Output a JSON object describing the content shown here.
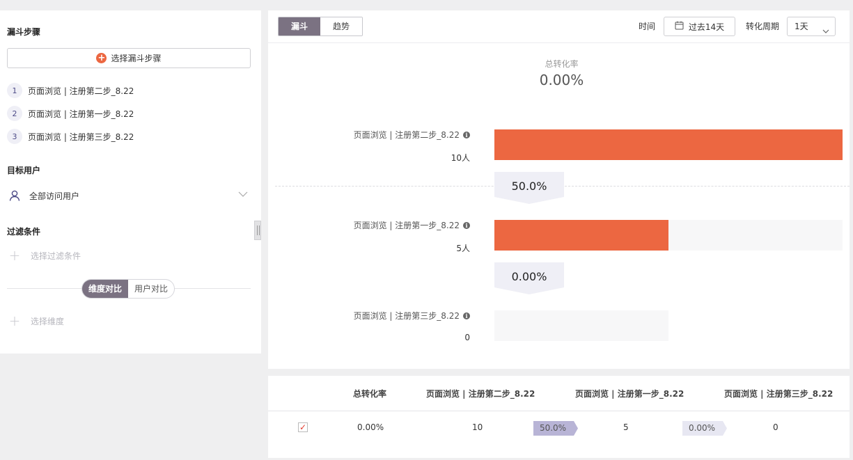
{
  "left_panel": {
    "funnel_steps_title": "漏斗步骤",
    "select_steps_label": "选择漏斗步骤",
    "steps": [
      {
        "num": "1",
        "label": "页面浏览 | 注册第二步_8.22"
      },
      {
        "num": "2",
        "label": "页面浏览 | 注册第一步_8.22"
      },
      {
        "num": "3",
        "label": "页面浏览 | 注册第三步_8.22"
      }
    ],
    "target_users_title": "目标用户",
    "target_users_value": "全部访问用户",
    "filter_title": "过滤条件",
    "filter_placeholder": "选择过滤条件",
    "compare_tabs": [
      "维度对比",
      "用户对比"
    ],
    "dimension_placeholder": "选择维度"
  },
  "toolbar": {
    "view_tabs": [
      "漏斗",
      "趋势"
    ],
    "active_tab": "漏斗",
    "time_label": "时间",
    "date_range": "过去14天",
    "period_label": "转化周期",
    "period_value": "1天"
  },
  "chart_data": {
    "type": "bar",
    "title": "总转化率",
    "total_conversion": "0.00%",
    "categories": [
      "页面浏览 | 注册第二步_8.22",
      "页面浏览 | 注册第一步_8.22",
      "页面浏览 | 注册第三步_8.22"
    ],
    "count_labels": [
      "10人",
      "5人",
      "0"
    ],
    "values": [
      10,
      5,
      0
    ],
    "step_conversions": [
      "50.0%",
      "0.00%"
    ],
    "colors": {
      "bar": "#ec6741",
      "track": "#f7f7f8"
    }
  },
  "table": {
    "headers": [
      "总转化率",
      "页面浏览 | 注册第二步_8.22",
      "页面浏览 | 注册第一步_8.22",
      "页面浏览 | 注册第三步_8.22"
    ],
    "row": {
      "checked_mark": "✓",
      "total_conversion": "0.00%",
      "step1": "10",
      "conv1": "50.0%",
      "step2": "5",
      "conv2": "0.00%",
      "step3": "0"
    }
  }
}
